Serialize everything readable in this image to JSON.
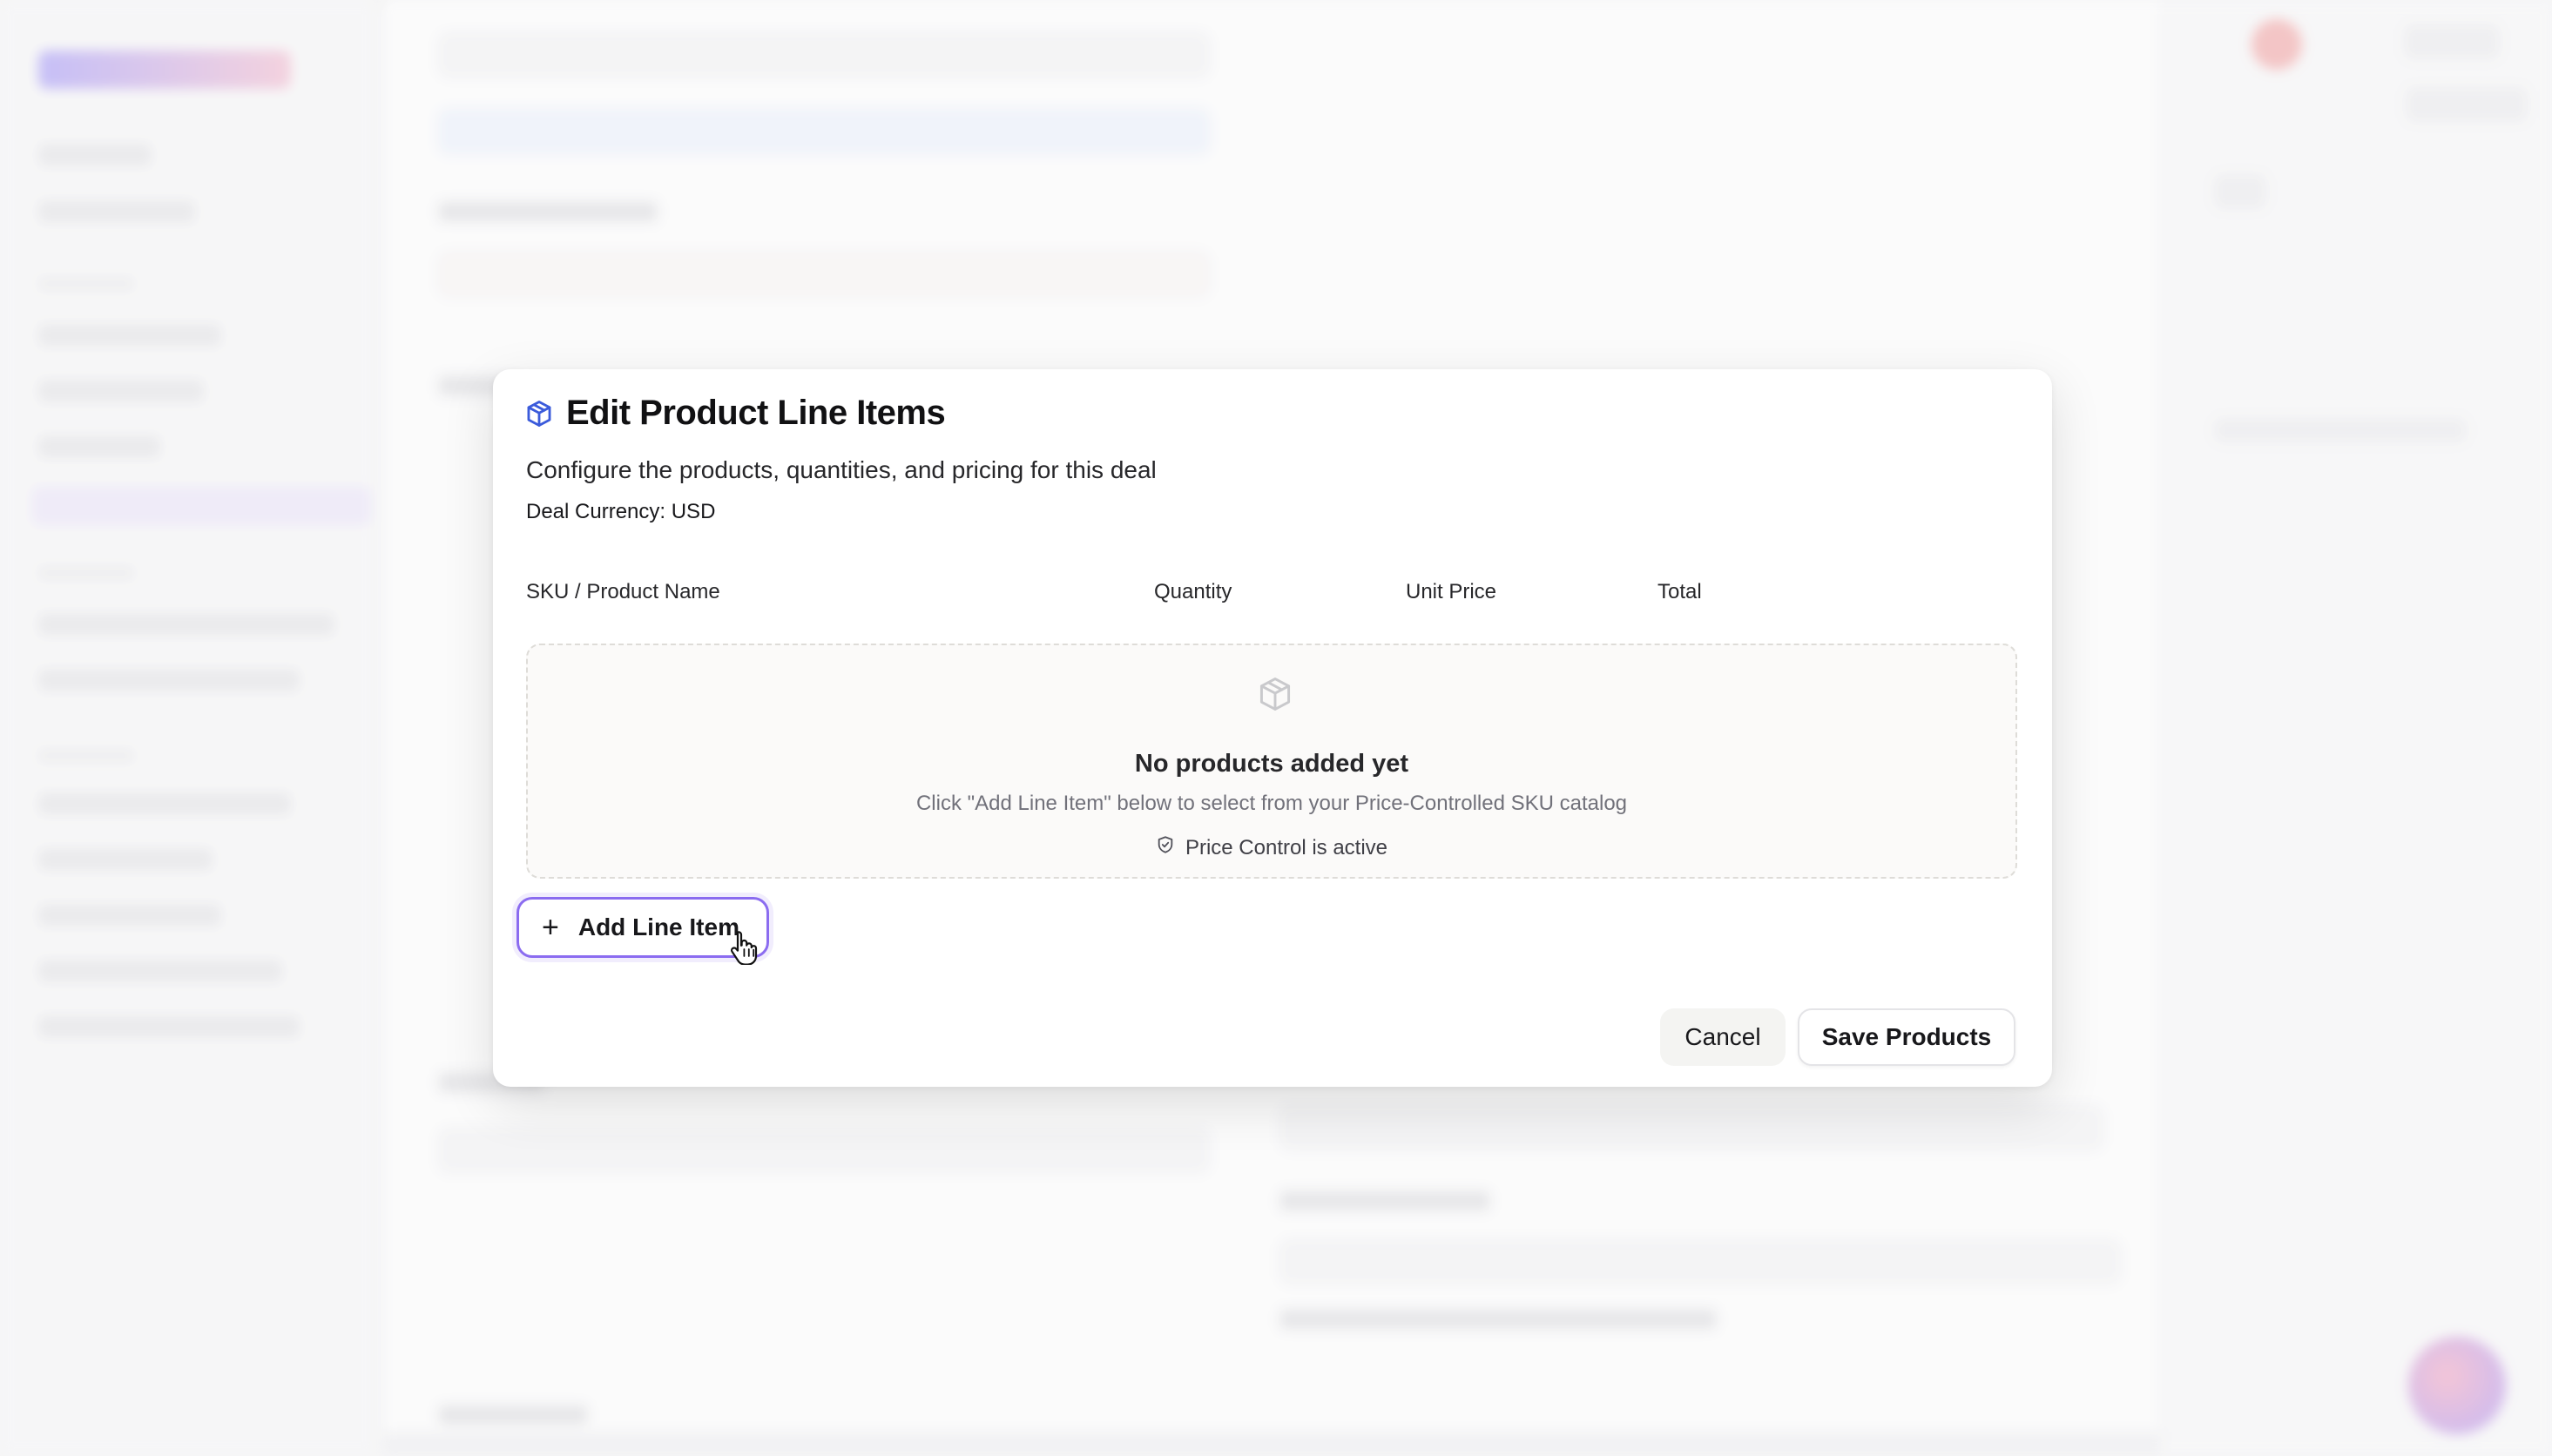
{
  "dialog": {
    "title": "Edit Product Line Items",
    "title_icon": "package-icon",
    "subtitle": "Configure the products, quantities, and pricing for this deal",
    "currency_line": "Deal Currency: USD",
    "columns": [
      "SKU / Product Name",
      "Quantity",
      "Unit Price",
      "Total"
    ],
    "empty_state": {
      "icon": "package-icon",
      "title": "No products added yet",
      "description": "Click \"Add Line Item\" below to select from your Price-Controlled SKU catalog",
      "price_control_icon": "shield-check-icon",
      "price_control_text": "Price Control is active"
    },
    "add_button": {
      "icon": "plus-icon",
      "label": "Add Line Item"
    },
    "cancel_label": "Cancel",
    "save_label": "Save Products"
  },
  "colors": {
    "accent": "#8b6cf0",
    "title_icon": "#3b5bdb",
    "muted_text": "#71717a"
  }
}
